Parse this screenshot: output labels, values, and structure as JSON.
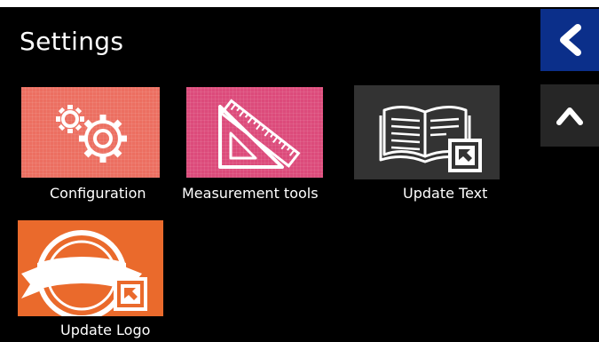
{
  "header": {
    "title": "Settings"
  },
  "nav": {
    "back_icon": "chevron-left-icon",
    "up_icon": "chevron-up-icon"
  },
  "tiles": [
    {
      "label": "Configuration",
      "icon": "gears-icon",
      "color": "#ec6f61"
    },
    {
      "label": "Measurement tools",
      "icon": "ruler-triangle-icon",
      "color": "#dc4b7b"
    },
    {
      "label": "Update Text",
      "icon": "open-book-shortcut-icon",
      "color": "#333333"
    },
    {
      "label": "Update Logo",
      "icon": "badge-ribbon-shortcut-icon",
      "color": "#ea6a2c"
    }
  ],
  "colors": {
    "background": "#000000",
    "back_button": "#0b2f8a",
    "up_button": "#262626"
  }
}
